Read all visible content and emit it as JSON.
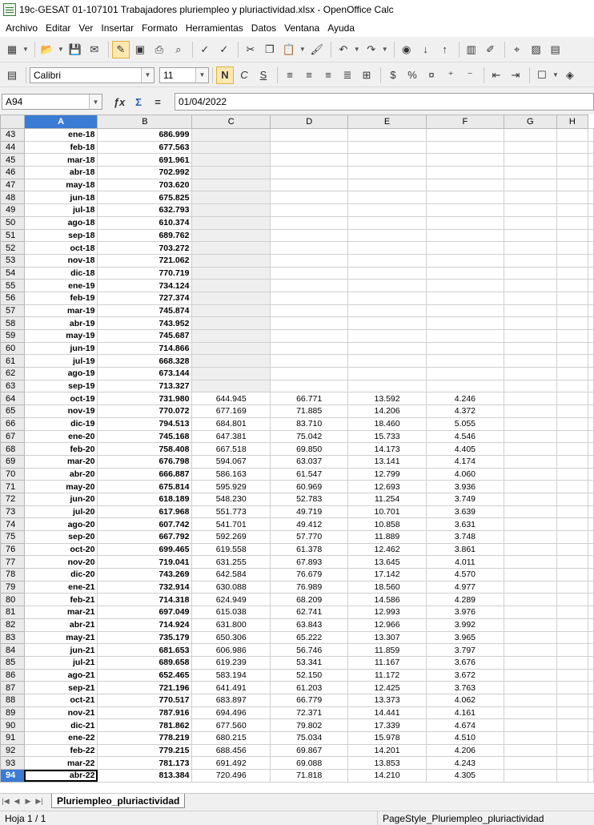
{
  "window": {
    "title": "19c-GESAT 01-107101 Trabajadores pluriempleo y pluriactividad.xlsx - OpenOffice Calc"
  },
  "menubar": [
    {
      "label": "Archivo"
    },
    {
      "label": "Editar"
    },
    {
      "label": "Ver"
    },
    {
      "label": "Insertar"
    },
    {
      "label": "Formato"
    },
    {
      "label": "Herramientas"
    },
    {
      "label": "Datos"
    },
    {
      "label": "Ventana"
    },
    {
      "label": "Ayuda"
    }
  ],
  "toolbar1": {
    "icons": [
      "new-document-icon",
      "open-folder-icon",
      "save-icon",
      "email-icon",
      "edit-file-icon",
      "export-pdf-icon",
      "print-icon",
      "page-preview-icon",
      "spellcheck-icon",
      "autospellcheck-icon",
      "cut-icon",
      "copy-icon",
      "paste-icon",
      "format-paintbrush-icon",
      "undo-icon",
      "redo-icon",
      "navigator-globe-icon",
      "sort-ascending-icon",
      "sort-descending-icon",
      "insert-chart-icon",
      "draw-functions-icon",
      "find-binoculars-icon",
      "gallery-icon",
      "data-sources-icon"
    ]
  },
  "toolbar2": {
    "font_name": "Calibri",
    "font_size": "11",
    "bold_label": "N",
    "italic_label": "C",
    "underline_label": "S"
  },
  "formulabar": {
    "name_box": "A94",
    "formula": "01/04/2022"
  },
  "columns": [
    "A",
    "B",
    "C",
    "D",
    "E",
    "F",
    "G",
    "H"
  ],
  "rows": [
    {
      "n": "43",
      "a": "ene-18",
      "b": "686.999",
      "c": "",
      "d": "",
      "e": "",
      "f": ""
    },
    {
      "n": "44",
      "a": "feb-18",
      "b": "677.563",
      "c": "",
      "d": "",
      "e": "",
      "f": ""
    },
    {
      "n": "45",
      "a": "mar-18",
      "b": "691.961",
      "c": "",
      "d": "",
      "e": "",
      "f": ""
    },
    {
      "n": "46",
      "a": "abr-18",
      "b": "702.992",
      "c": "",
      "d": "",
      "e": "",
      "f": ""
    },
    {
      "n": "47",
      "a": "may-18",
      "b": "703.620",
      "c": "",
      "d": "",
      "e": "",
      "f": ""
    },
    {
      "n": "48",
      "a": "jun-18",
      "b": "675.825",
      "c": "",
      "d": "",
      "e": "",
      "f": ""
    },
    {
      "n": "49",
      "a": "jul-18",
      "b": "632.793",
      "c": "",
      "d": "",
      "e": "",
      "f": ""
    },
    {
      "n": "50",
      "a": "ago-18",
      "b": "610.374",
      "c": "",
      "d": "",
      "e": "",
      "f": ""
    },
    {
      "n": "51",
      "a": "sep-18",
      "b": "689.762",
      "c": "",
      "d": "",
      "e": "",
      "f": ""
    },
    {
      "n": "52",
      "a": "oct-18",
      "b": "703.272",
      "c": "",
      "d": "",
      "e": "",
      "f": ""
    },
    {
      "n": "53",
      "a": "nov-18",
      "b": "721.062",
      "c": "",
      "d": "",
      "e": "",
      "f": ""
    },
    {
      "n": "54",
      "a": "dic-18",
      "b": "770.719",
      "c": "",
      "d": "",
      "e": "",
      "f": ""
    },
    {
      "n": "55",
      "a": "ene-19",
      "b": "734.124",
      "c": "",
      "d": "",
      "e": "",
      "f": ""
    },
    {
      "n": "56",
      "a": "feb-19",
      "b": "727.374",
      "c": "",
      "d": "",
      "e": "",
      "f": ""
    },
    {
      "n": "57",
      "a": "mar-19",
      "b": "745.874",
      "c": "",
      "d": "",
      "e": "",
      "f": ""
    },
    {
      "n": "58",
      "a": "abr-19",
      "b": "743.952",
      "c": "",
      "d": "",
      "e": "",
      "f": ""
    },
    {
      "n": "59",
      "a": "may-19",
      "b": "745.687",
      "c": "",
      "d": "",
      "e": "",
      "f": ""
    },
    {
      "n": "60",
      "a": "jun-19",
      "b": "714.866",
      "c": "",
      "d": "",
      "e": "",
      "f": ""
    },
    {
      "n": "61",
      "a": "jul-19",
      "b": "668.328",
      "c": "",
      "d": "",
      "e": "",
      "f": ""
    },
    {
      "n": "62",
      "a": "ago-19",
      "b": "673.144",
      "c": "",
      "d": "",
      "e": "",
      "f": ""
    },
    {
      "n": "63",
      "a": "sep-19",
      "b": "713.327",
      "c": "",
      "d": "",
      "e": "",
      "f": ""
    },
    {
      "n": "64",
      "a": "oct-19",
      "b": "731.980",
      "c": "644.945",
      "d": "66.771",
      "e": "13.592",
      "f": "4.246"
    },
    {
      "n": "65",
      "a": "nov-19",
      "b": "770.072",
      "c": "677.169",
      "d": "71.885",
      "e": "14.206",
      "f": "4.372"
    },
    {
      "n": "66",
      "a": "dic-19",
      "b": "794.513",
      "c": "684.801",
      "d": "83.710",
      "e": "18.460",
      "f": "5.055"
    },
    {
      "n": "67",
      "a": "ene-20",
      "b": "745.168",
      "c": "647.381",
      "d": "75.042",
      "e": "15.733",
      "f": "4.546"
    },
    {
      "n": "68",
      "a": "feb-20",
      "b": "758.408",
      "c": "667.518",
      "d": "69.850",
      "e": "14.173",
      "f": "4.405"
    },
    {
      "n": "69",
      "a": "mar-20",
      "b": "676.798",
      "c": "594.067",
      "d": "63.037",
      "e": "13.141",
      "f": "4.174"
    },
    {
      "n": "70",
      "a": "abr-20",
      "b": "666.887",
      "c": "586.163",
      "d": "61.547",
      "e": "12.799",
      "f": "4.060"
    },
    {
      "n": "71",
      "a": "may-20",
      "b": "675.814",
      "c": "595.929",
      "d": "60.969",
      "e": "12.693",
      "f": "3.936"
    },
    {
      "n": "72",
      "a": "jun-20",
      "b": "618.189",
      "c": "548.230",
      "d": "52.783",
      "e": "11.254",
      "f": "3.749"
    },
    {
      "n": "73",
      "a": "jul-20",
      "b": "617.968",
      "c": "551.773",
      "d": "49.719",
      "e": "10.701",
      "f": "3.639"
    },
    {
      "n": "74",
      "a": "ago-20",
      "b": "607.742",
      "c": "541.701",
      "d": "49.412",
      "e": "10.858",
      "f": "3.631"
    },
    {
      "n": "75",
      "a": "sep-20",
      "b": "667.792",
      "c": "592.269",
      "d": "57.770",
      "e": "11.889",
      "f": "3.748"
    },
    {
      "n": "76",
      "a": "oct-20",
      "b": "699.465",
      "c": "619.558",
      "d": "61.378",
      "e": "12.462",
      "f": "3.861"
    },
    {
      "n": "77",
      "a": "nov-20",
      "b": "719.041",
      "c": "631.255",
      "d": "67.893",
      "e": "13.645",
      "f": "4.011"
    },
    {
      "n": "78",
      "a": "dic-20",
      "b": "743.269",
      "c": "642.584",
      "d": "76.679",
      "e": "17.142",
      "f": "4.570"
    },
    {
      "n": "79",
      "a": "ene-21",
      "b": "732.914",
      "c": "630.088",
      "d": "76.989",
      "e": "18.560",
      "f": "4.977"
    },
    {
      "n": "80",
      "a": "feb-21",
      "b": "714.318",
      "c": "624.949",
      "d": "68.209",
      "e": "14.586",
      "f": "4.289"
    },
    {
      "n": "81",
      "a": "mar-21",
      "b": "697.049",
      "c": "615.038",
      "d": "62.741",
      "e": "12.993",
      "f": "3.976"
    },
    {
      "n": "82",
      "a": "abr-21",
      "b": "714.924",
      "c": "631.800",
      "d": "63.843",
      "e": "12.966",
      "f": "3.992"
    },
    {
      "n": "83",
      "a": "may-21",
      "b": "735.179",
      "c": "650.306",
      "d": "65.222",
      "e": "13.307",
      "f": "3.965"
    },
    {
      "n": "84",
      "a": "jun-21",
      "b": "681.653",
      "c": "606.986",
      "d": "56.746",
      "e": "11.859",
      "f": "3.797"
    },
    {
      "n": "85",
      "a": "jul-21",
      "b": "689.658",
      "c": "619.239",
      "d": "53.341",
      "e": "11.167",
      "f": "3.676"
    },
    {
      "n": "86",
      "a": "ago-21",
      "b": "652.465",
      "c": "583.194",
      "d": "52.150",
      "e": "11.172",
      "f": "3.672"
    },
    {
      "n": "87",
      "a": "sep-21",
      "b": "721.196",
      "c": "641.491",
      "d": "61.203",
      "e": "12.425",
      "f": "3.763"
    },
    {
      "n": "88",
      "a": "oct-21",
      "b": "770.517",
      "c": "683.897",
      "d": "66.779",
      "e": "13.373",
      "f": "4.062"
    },
    {
      "n": "89",
      "a": "nov-21",
      "b": "787.916",
      "c": "694.496",
      "d": "72.371",
      "e": "14.441",
      "f": "4.161"
    },
    {
      "n": "90",
      "a": "dic-21",
      "b": "781.862",
      "c": "677.560",
      "d": "79.802",
      "e": "17.339",
      "f": "4.674"
    },
    {
      "n": "91",
      "a": "ene-22",
      "b": "778.219",
      "c": "680.215",
      "d": "75.034",
      "e": "15.978",
      "f": "4.510"
    },
    {
      "n": "92",
      "a": "feb-22",
      "b": "779.215",
      "c": "688.456",
      "d": "69.867",
      "e": "14.201",
      "f": "4.206"
    },
    {
      "n": "93",
      "a": "mar-22",
      "b": "781.173",
      "c": "691.492",
      "d": "69.088",
      "e": "13.853",
      "f": "4.243"
    },
    {
      "n": "94",
      "a": "abr-22",
      "b": "813.384",
      "c": "720.496",
      "d": "71.818",
      "e": "14.210",
      "f": "4.305"
    }
  ],
  "selected_row": "94",
  "sheet_tab": "Pluriempleo_pluriactividad",
  "status": {
    "sheet_info": "Hoja 1 / 1",
    "page_style": "PageStyle_Pluriempleo_pluriactividad"
  }
}
